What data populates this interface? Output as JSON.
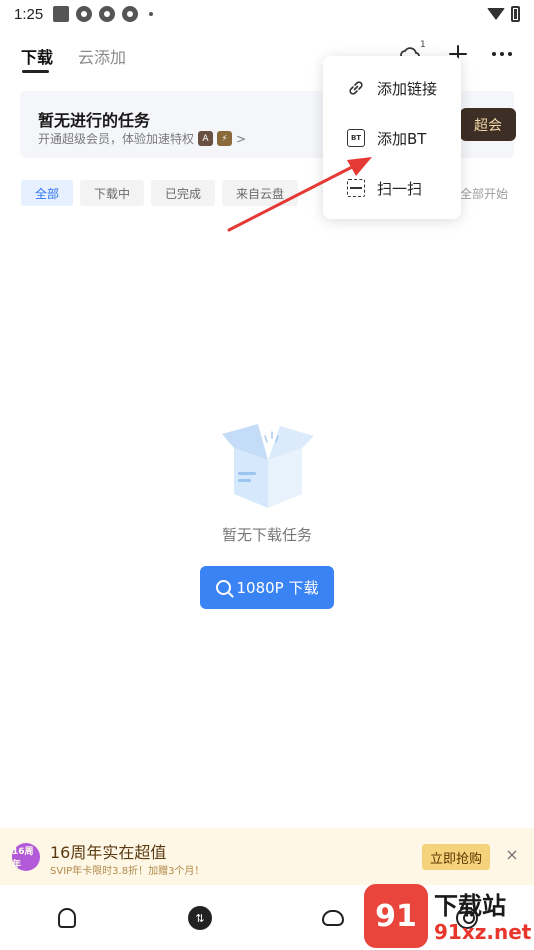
{
  "status": {
    "time": "1:25"
  },
  "tabs": [
    {
      "label": "下载",
      "active": true
    },
    {
      "label": "云添加",
      "active": false
    }
  ],
  "top_actions": {
    "cloud_badge": "1"
  },
  "promo": {
    "title": "暂无进行的任务",
    "subtitle": "开通超级会员，体验加速特权",
    "badge_a": "A",
    "badge_b": "⚡",
    "chevron": ">",
    "button": "超会"
  },
  "filters": [
    "全部",
    "下载中",
    "已完成",
    "来自云盘"
  ],
  "start_all": "全部开始",
  "menu": {
    "items": [
      "添加链接",
      "添加BT",
      "扫一扫"
    ],
    "bt_icon_text": "BT"
  },
  "empty": {
    "text": "暂无下载任务",
    "button": "1080P 下载"
  },
  "banner": {
    "badge": "16周年",
    "title": "16周年实在超值",
    "subtitle": "SVIP年卡限时3.8折！加赠3个月！",
    "button": "立即抢购",
    "close": "×"
  },
  "watermark": {
    "mark": "91",
    "text": "下载站",
    "url": "91xz.net"
  },
  "colors": {
    "accent": "#3a83f4",
    "arrow": "#e53935",
    "banner_bg": "#fff7e6",
    "promo_button": "#3d2f25"
  }
}
